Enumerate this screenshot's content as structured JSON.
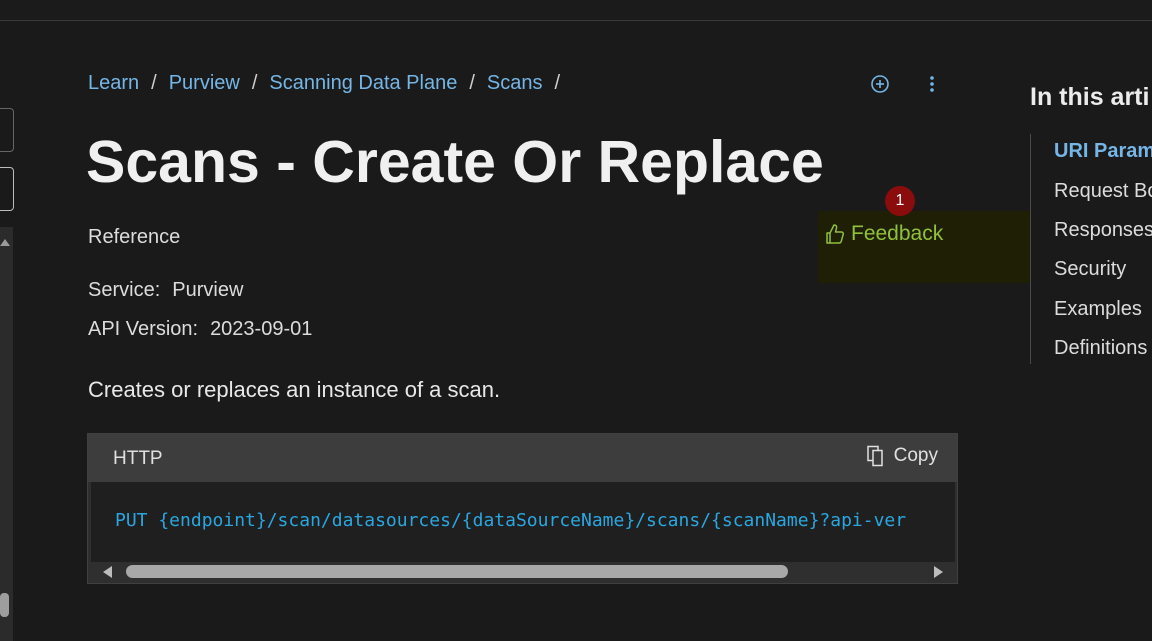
{
  "breadcrumb": {
    "items": [
      "Learn",
      "Purview",
      "Scanning Data Plane",
      "Scans"
    ],
    "separator": "/"
  },
  "actions": {
    "add_icon": "circle-plus-icon",
    "more_icon": "vertical-ellipsis-icon"
  },
  "title": "Scans - Create Or Replace",
  "reference": "Reference",
  "service": {
    "label": "Service:",
    "value": "Purview"
  },
  "api_version": {
    "label": "API Version:",
    "value": "2023-09-01"
  },
  "description": "Creates or replaces an instance of a scan.",
  "feedback": {
    "label": "Feedback",
    "icon": "thumbs-up-icon",
    "badge": "1"
  },
  "code": {
    "language": "HTTP",
    "copy_label": "Copy",
    "copy_icon": "copy-icon",
    "line": "PUT {endpoint}/scan/datasources/{dataSourceName}/scans/{scanName}?api-ver"
  },
  "toc": {
    "heading": "In this arti",
    "items": [
      "URI Param",
      "Request Bo",
      "Responses",
      "Security",
      "Examples",
      "Definitions"
    ],
    "active_index": 0
  },
  "colors": {
    "background": "#1a1a1a",
    "link": "#75b6e7",
    "feedback": "#8fc23a",
    "code_text": "#2aa7e0",
    "badge": "#8b0c0c"
  }
}
